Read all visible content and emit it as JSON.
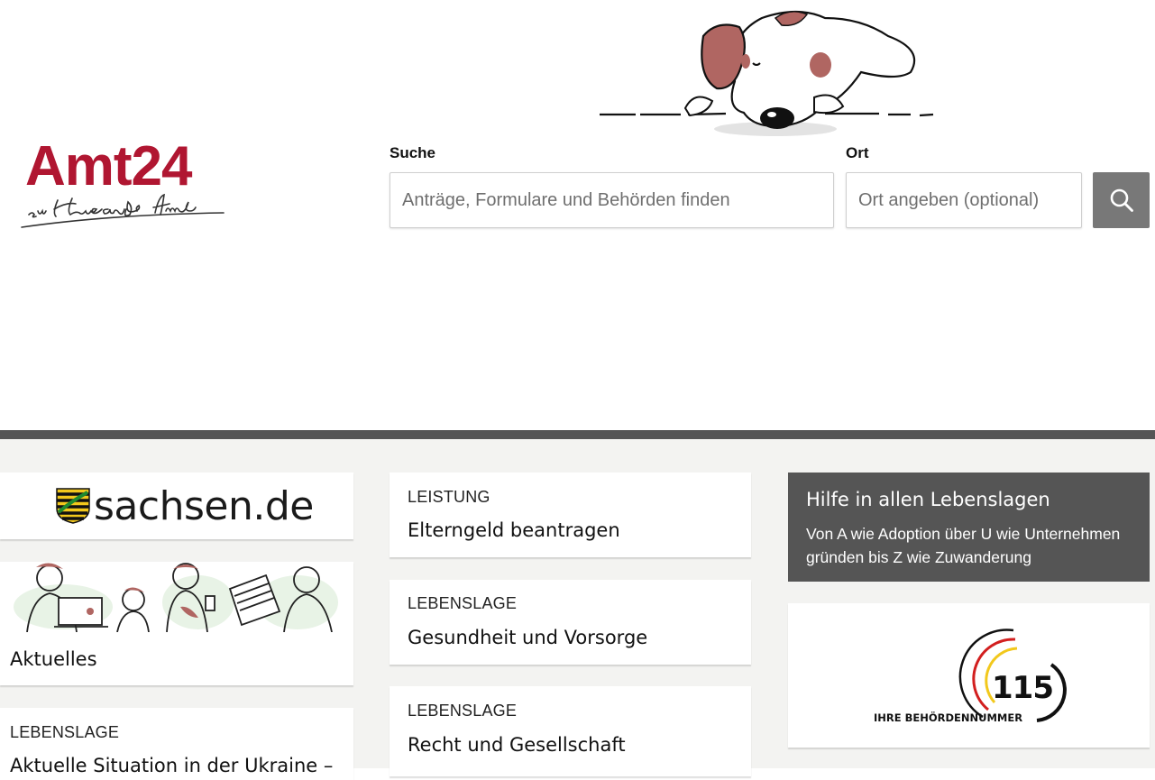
{
  "header": {
    "logo": {
      "brand": "Amt24",
      "slogan": "zu Hause aufs Amt"
    },
    "search": {
      "label": "Suche",
      "placeholder": "Anträge, Formulare und Behörden finden"
    },
    "location": {
      "label": "Ort",
      "placeholder": "Ort angeben (optional)"
    },
    "search_button_icon": "search-icon",
    "illustration": "dog-illustration"
  },
  "colors": {
    "brand": "#b01631",
    "divider": "#555555",
    "background_gray": "#f3f3f1",
    "help_card": "#555555",
    "button": "#787878"
  },
  "left_column": {
    "sachsen": {
      "text": "sachsen.de",
      "icon": "saxony-coat-of-arms-icon"
    },
    "news": {
      "title": "Aktuelles",
      "image": "people-illustration"
    },
    "lebenslage_card": {
      "kicker": "LEBENSLAGE",
      "title": "Aktuelle Situation in der Ukraine –"
    }
  },
  "middle_column": {
    "cards": [
      {
        "kicker": "LEISTUNG",
        "title": "Elterngeld beantragen"
      },
      {
        "kicker": "LEBENSLAGE",
        "title": "Gesundheit und Vorsorge"
      },
      {
        "kicker": "LEBENSLAGE",
        "title": "Recht und Gesellschaft"
      }
    ]
  },
  "right_column": {
    "help": {
      "title": "Hilfe in allen Lebenslagen",
      "text": "Von A wie Adoption über U wie Unternehmen gründen bis Z wie Zuwanderung"
    },
    "hotline": {
      "number": "115",
      "caption": "IHRE BEHÖRDENNUMMER"
    }
  }
}
